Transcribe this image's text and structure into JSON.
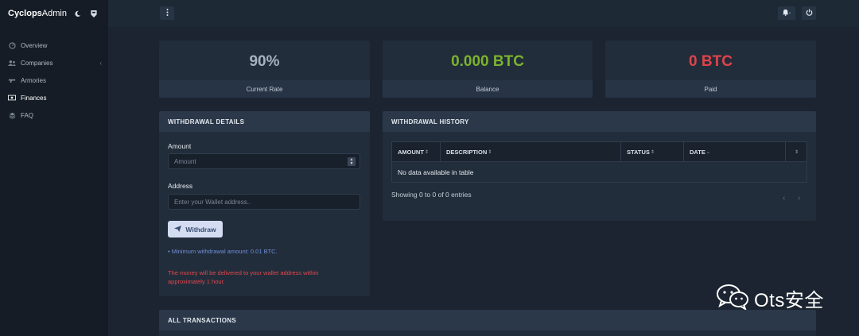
{
  "brand": {
    "prefix": "Cyclops",
    "suffix": "Admin"
  },
  "sidebar": {
    "items": [
      {
        "label": "Overview",
        "icon": "gauge-icon",
        "active": false
      },
      {
        "label": "Companies",
        "icon": "users-icon",
        "active": false,
        "expandable": true
      },
      {
        "label": "Armories",
        "icon": "gun-icon",
        "active": false
      },
      {
        "label": "Finances",
        "icon": "money-icon",
        "active": true
      },
      {
        "label": "FAQ",
        "icon": "layers-icon",
        "active": false
      }
    ]
  },
  "stats": [
    {
      "value": "90%",
      "label": "Current Rate",
      "color": "#a7b2c0"
    },
    {
      "value": "0.000 BTC",
      "label": "Balance",
      "color": "#7bb32e"
    },
    {
      "value": "0 BTC",
      "label": "Paid",
      "color": "#e0434a"
    }
  ],
  "withdrawal": {
    "title": "WITHDRAWAL DETAILS",
    "amount_label": "Amount",
    "amount_placeholder": "Amount",
    "address_label": "Address",
    "address_placeholder": "Enter your Wallet address..",
    "button_label": "Withdraw",
    "min_note": "• Minimum withdrawal amount: 0.01 BTC.",
    "delivery_note": "The money will be delivered to your wallet address within approximately 1 hour."
  },
  "history": {
    "title": "WITHDRAWAL HISTORY",
    "columns": [
      "AMOUNT",
      "DESCRIPTION",
      "STATUS",
      "DATE",
      ""
    ],
    "empty_text": "No data available in table",
    "info": "Showing 0 to 0 of 0 entries"
  },
  "transactions": {
    "title": "ALL TRANSACTIONS"
  },
  "watermark": "Ots安全"
}
